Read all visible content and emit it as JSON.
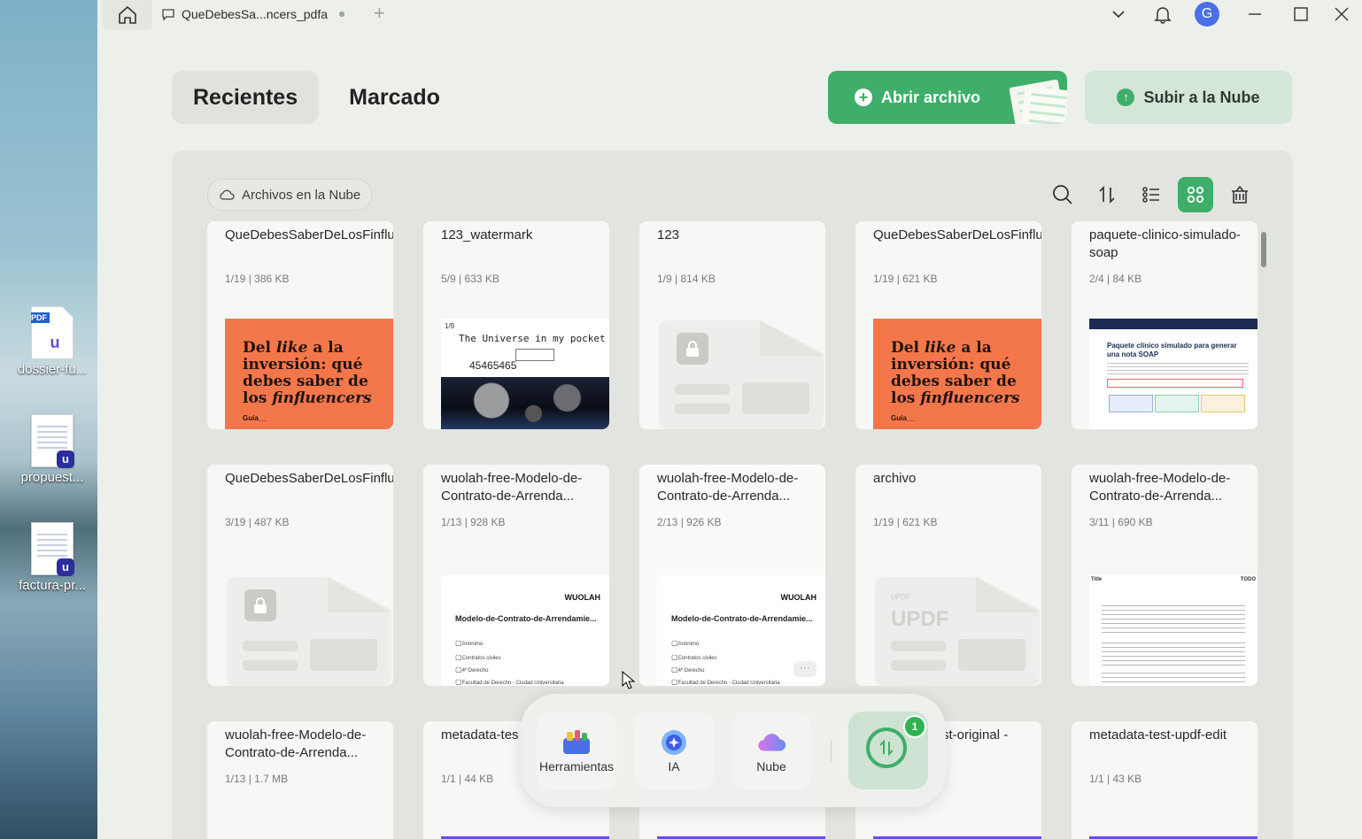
{
  "desktop": {
    "icons": [
      {
        "label": "dossier-fu...",
        "badge": "PDF"
      },
      {
        "label": "propuest..."
      },
      {
        "label": "factura-pr..."
      }
    ]
  },
  "titlebar": {
    "tab_title": "QueDebesSa...ncers_pdfa",
    "avatar_letter": "G"
  },
  "nav": {
    "tabs": [
      {
        "label": "Recientes",
        "active": true
      },
      {
        "label": "Marcado",
        "active": false
      }
    ],
    "open_file": "Abrir archivo",
    "upload_cloud": "Subir a la Nube"
  },
  "panel": {
    "cloud_files": "Archivos en la Nube"
  },
  "files": [
    {
      "name": "QueDebesSaberDeLosFinfluencers_pdfa",
      "meta": "1/19 | 386 KB",
      "thumb": "orange"
    },
    {
      "name": "123_watermark",
      "meta": "5/9 | 633 KB",
      "thumb": "universe"
    },
    {
      "name": "123",
      "meta": "1/9 | 814 KB",
      "thumb": "locked"
    },
    {
      "name": "QueDebesSaberDeLosFinfluencers",
      "meta": "1/19 | 621 KB",
      "thumb": "orange"
    },
    {
      "name": "paquete-clinico-simulado-soap",
      "meta": "2/4 | 84 KB",
      "thumb": "soap"
    },
    {
      "name": "QueDebesSaberDeLosFinfluencerscontraseña",
      "meta": "3/19 | 487 KB",
      "thumb": "locked"
    },
    {
      "name": "wuolah-free-Modelo-de-Contrato-de-Arrenda...",
      "meta": "1/13 | 928 KB",
      "thumb": "contract"
    },
    {
      "name": "wuolah-free-Modelo-de-Contrato-de-Arrenda...",
      "meta": "2/13 | 926 KB",
      "thumb": "contract"
    },
    {
      "name": "archivo",
      "meta": "1/19 | 621 KB",
      "thumb": "updf"
    },
    {
      "name": "wuolah-free-Modelo-de-Contrato-de-Arrenda...",
      "meta": "3/11 | 690 KB",
      "thumb": "text"
    },
    {
      "name": "wuolah-free-Modelo-de-Contrato-de-Arrenda...",
      "meta": "1/13 | 1.7 MB",
      "thumb": "none"
    },
    {
      "name": "metadata-tes",
      "meta": "1/1 | 44 KB",
      "thumb": "none"
    },
    {
      "name": "",
      "meta": "",
      "thumb": "none"
    },
    {
      "name": "st-original -",
      "meta": "",
      "thumb": "none"
    },
    {
      "name": "metadata-test-updf-edit",
      "meta": "1/1 | 43 KB",
      "thumb": "none"
    }
  ],
  "thumbs": {
    "orange_title_1": "Del ",
    "orange_title_italic": "like",
    "orange_title_2": " a la inversión: qué debes saber de los ",
    "orange_title_italic2": "finfluencers",
    "orange_guide": "Guía__",
    "universe_page": "1/9",
    "universe_title": "The Universe in my pocket",
    "universe_number": "45465465",
    "contract_logo": "WUOLAH",
    "contract_title": "Modelo-de-Contrato-de-Arrendamie...",
    "contract_items": [
      "Anónimo",
      "Contratos civiles",
      "4º Derecho",
      "Facultad de Derecho - Ciudad Universitaria"
    ],
    "updf_text": "UPDF",
    "updf_small": "UPDF",
    "soap_title": "Paquete clínico simulado para generar una nota SOAP",
    "textdoc_title": "Title",
    "textdoc_title2": "TODO"
  },
  "dock": {
    "items": [
      "Herramientas",
      "IA",
      "Nube"
    ],
    "sync_badge": "1"
  }
}
